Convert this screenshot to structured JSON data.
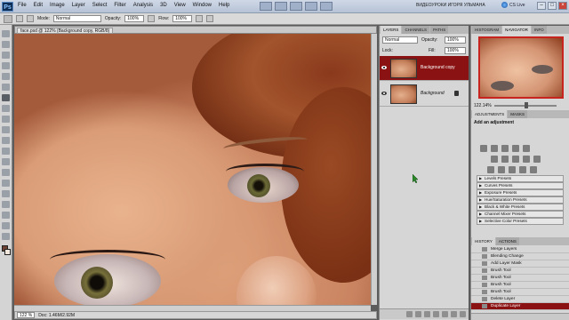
{
  "app": {
    "logo": "Ps",
    "menu": [
      "File",
      "Edit",
      "Image",
      "Layer",
      "Select",
      "Filter",
      "Analysis",
      "3D",
      "View",
      "Window",
      "Help"
    ],
    "workspace": "ВИДЕОУРОКИ ИГОРЯ УЛЬМАНА",
    "cslive": "CS Live"
  },
  "options": {
    "mode_label": "Mode:",
    "mode_value": "Normal",
    "opacity_label": "Opacity:",
    "opacity_value": "100%",
    "flow_label": "Flow:",
    "flow_value": "100%"
  },
  "document": {
    "tab_title": "face.psd @ 122% (Background copy, RGB/8)",
    "zoom": "122 %",
    "info": "Doc: 1.46M/2.92M"
  },
  "layers": {
    "tabs": [
      "LAYERS",
      "CHANNELS",
      "PATHS"
    ],
    "blend_mode": "Normal",
    "opacity_label": "Opacity:",
    "opacity_value": "100%",
    "lock_label": "Lock:",
    "fill_label": "Fill:",
    "fill_value": "100%",
    "items": [
      {
        "name": "Background copy",
        "selected": true
      },
      {
        "name": "Background",
        "selected": false
      }
    ]
  },
  "navigator": {
    "tabs": [
      "HISTOGRAM",
      "NAVIGATOR",
      "INFO"
    ],
    "zoom": "122.14%"
  },
  "adjustments": {
    "tabs": [
      "ADJUSTMENTS",
      "MASKS"
    ],
    "title": "Add an adjustment",
    "presets": [
      "Levels Presets",
      "Curves Presets",
      "Exposure Presets",
      "Hue/Saturation Presets",
      "Black & White Presets",
      "Channel Mixer Presets",
      "Selective Color Presets"
    ]
  },
  "history": {
    "tabs": [
      "HISTORY",
      "ACTIONS"
    ],
    "items": [
      {
        "label": "Merge Layers",
        "active": false
      },
      {
        "label": "Blending Change",
        "active": false
      },
      {
        "label": "Add Layer Mask",
        "active": false
      },
      {
        "label": "Brush Tool",
        "active": false
      },
      {
        "label": "Brush Tool",
        "active": false
      },
      {
        "label": "Brush Tool",
        "active": false
      },
      {
        "label": "Brush Tool",
        "active": false
      },
      {
        "label": "Delete Layer",
        "active": false
      },
      {
        "label": "Duplicate Layer",
        "active": true
      }
    ]
  },
  "colors": {
    "selection": "#8a1212",
    "foreground": "#6b4234",
    "background": "#f0e6dc"
  }
}
